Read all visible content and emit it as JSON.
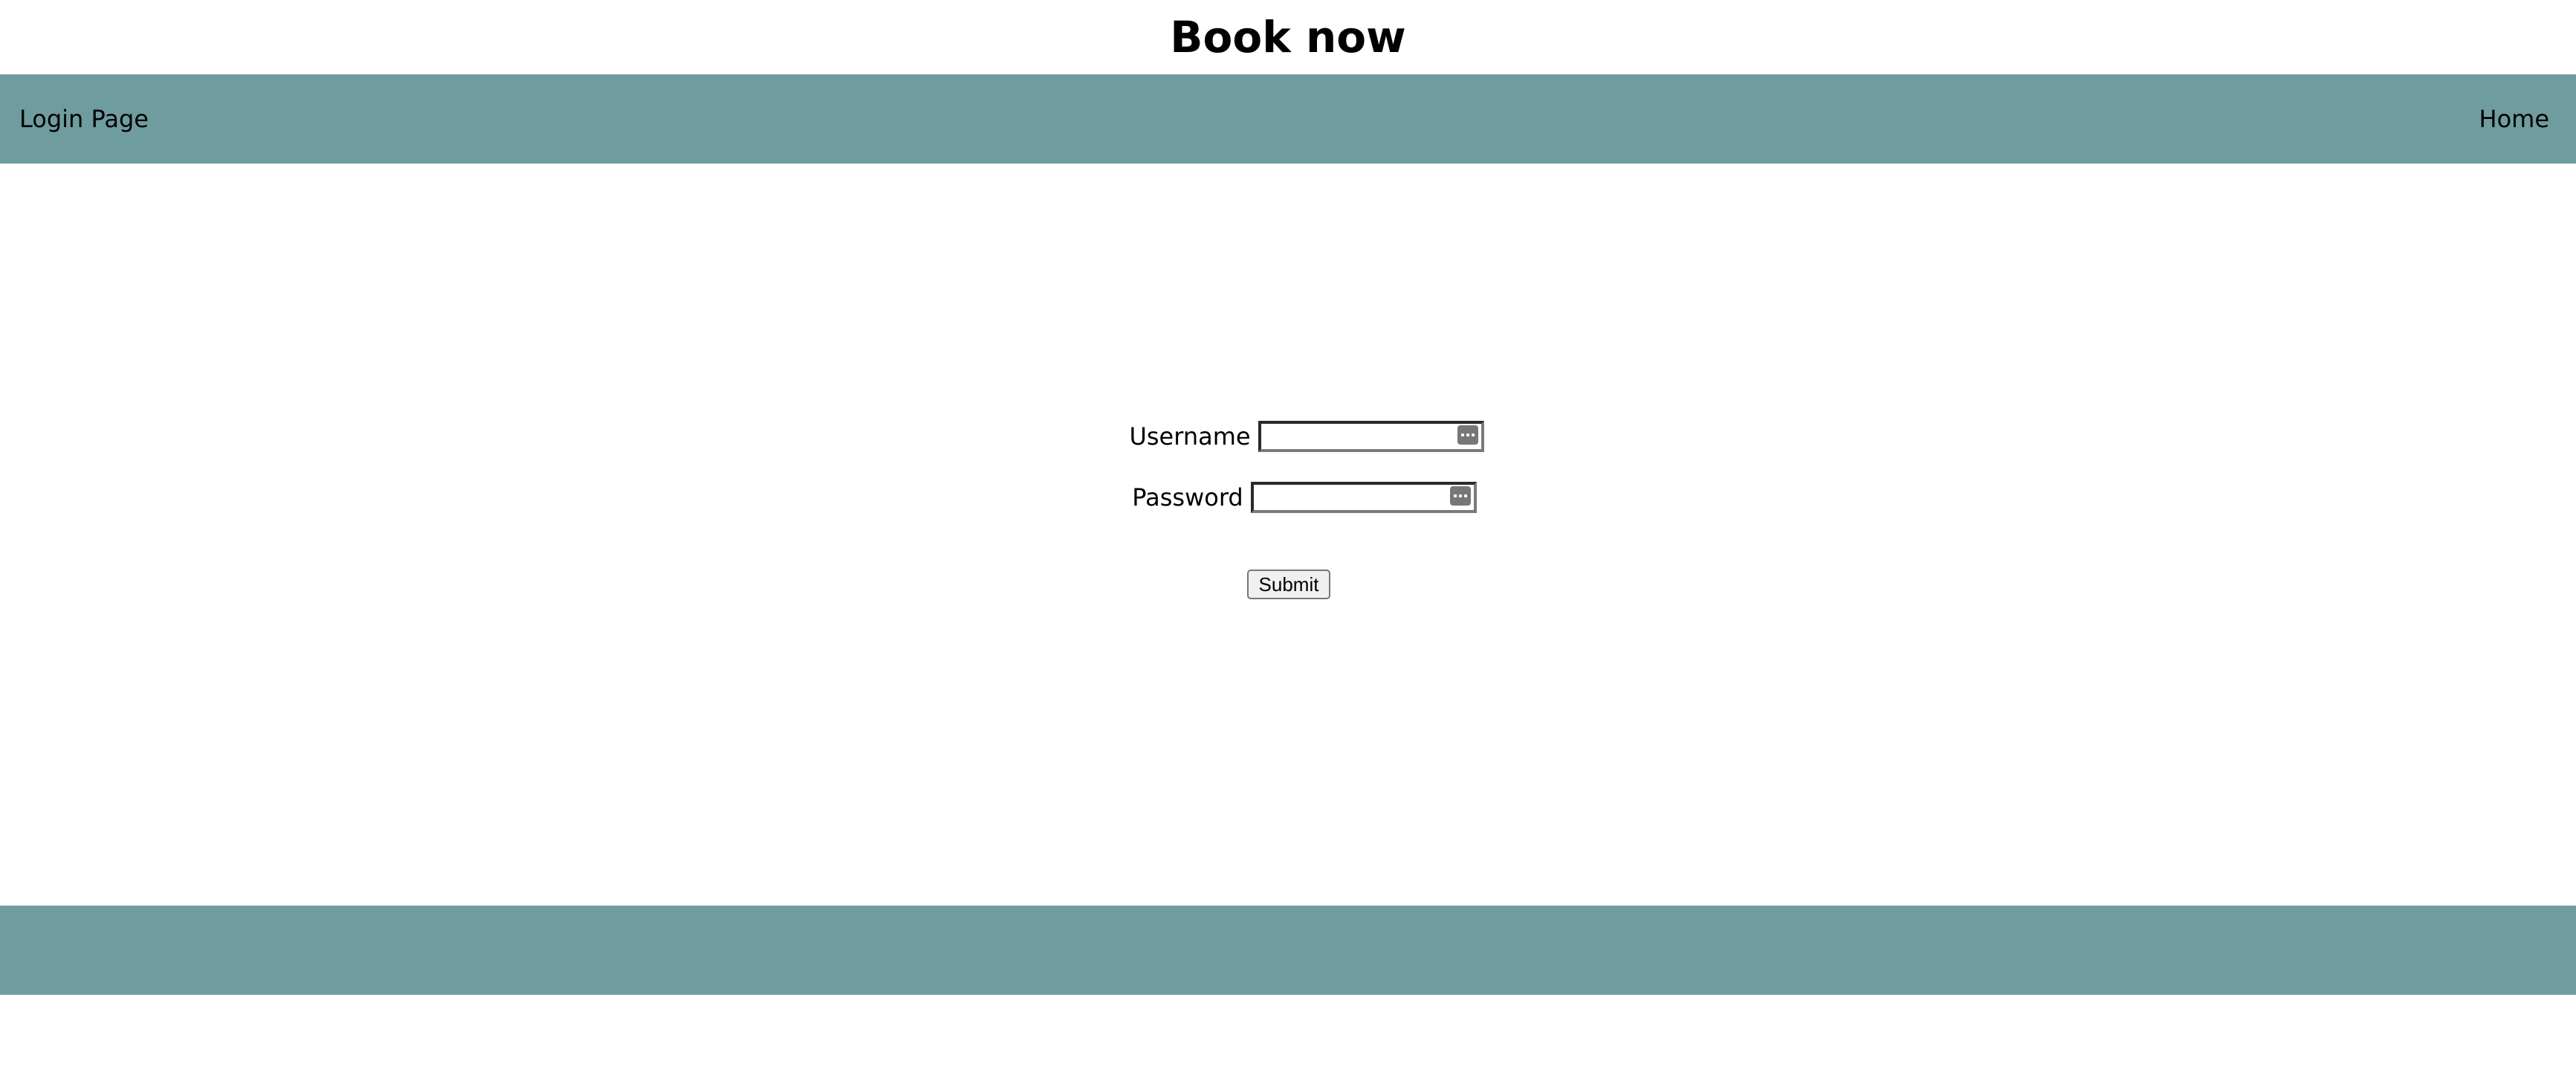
{
  "header": {
    "title": "Book now"
  },
  "navbar": {
    "left_label": "Login Page",
    "right_link": "Home",
    "color": "#6f9c9e"
  },
  "login_form": {
    "username_label": "Username",
    "username_value": "",
    "password_label": "Password",
    "password_value": "",
    "field_icon": "key-icon",
    "submit_label": "Submit"
  },
  "footer": {
    "color": "#6f9c9e"
  }
}
